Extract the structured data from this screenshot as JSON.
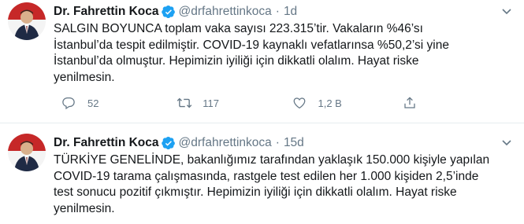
{
  "tweets": [
    {
      "name": "Dr. Fahrettin Koca",
      "handle": "@drfahrettinkoca",
      "separator": "·",
      "time": "1d",
      "text_lines": [
        "SALGIN BOYUNCA toplam vaka sayısı 223.315’tir. Vakaların %46’sı",
        "İstanbul’da tespit edilmiştir. COVID-19 kaynaklı vefatlarınsa %50,2’si yine",
        "İstanbul’da olmuştur. Hepimizin iyiliği için dikkatli olalım. Hayat riske",
        "yenilmesin."
      ],
      "replies": "52",
      "retweets": "117",
      "likes": "1,2 B"
    },
    {
      "name": "Dr. Fahrettin Koca",
      "handle": "@drfahrettinkoca",
      "separator": "·",
      "time": "15d",
      "text_lines": [
        "TÜRKİYE GENELİNDE, bakanlığımız tarafından yaklaşık 150.000 kişiyle yapılan",
        "COVID-19 tarama çalışmasında, rastgele test edilen her 1.000 kişiden 2,5’inde",
        "test sonucu pozitif çıkmıştır. Hepimizin iyiliği için dikkatli olalım. Hayat riske",
        "yenilmesin."
      ]
    }
  ],
  "colors": {
    "text": "#14171a",
    "secondary": "#657786",
    "verified": "#1da1f2",
    "divider": "#e6ecf0"
  },
  "icons": [
    "verified-badge-icon",
    "chevron-down-icon",
    "reply-icon",
    "retweet-icon",
    "like-icon",
    "share-icon"
  ]
}
